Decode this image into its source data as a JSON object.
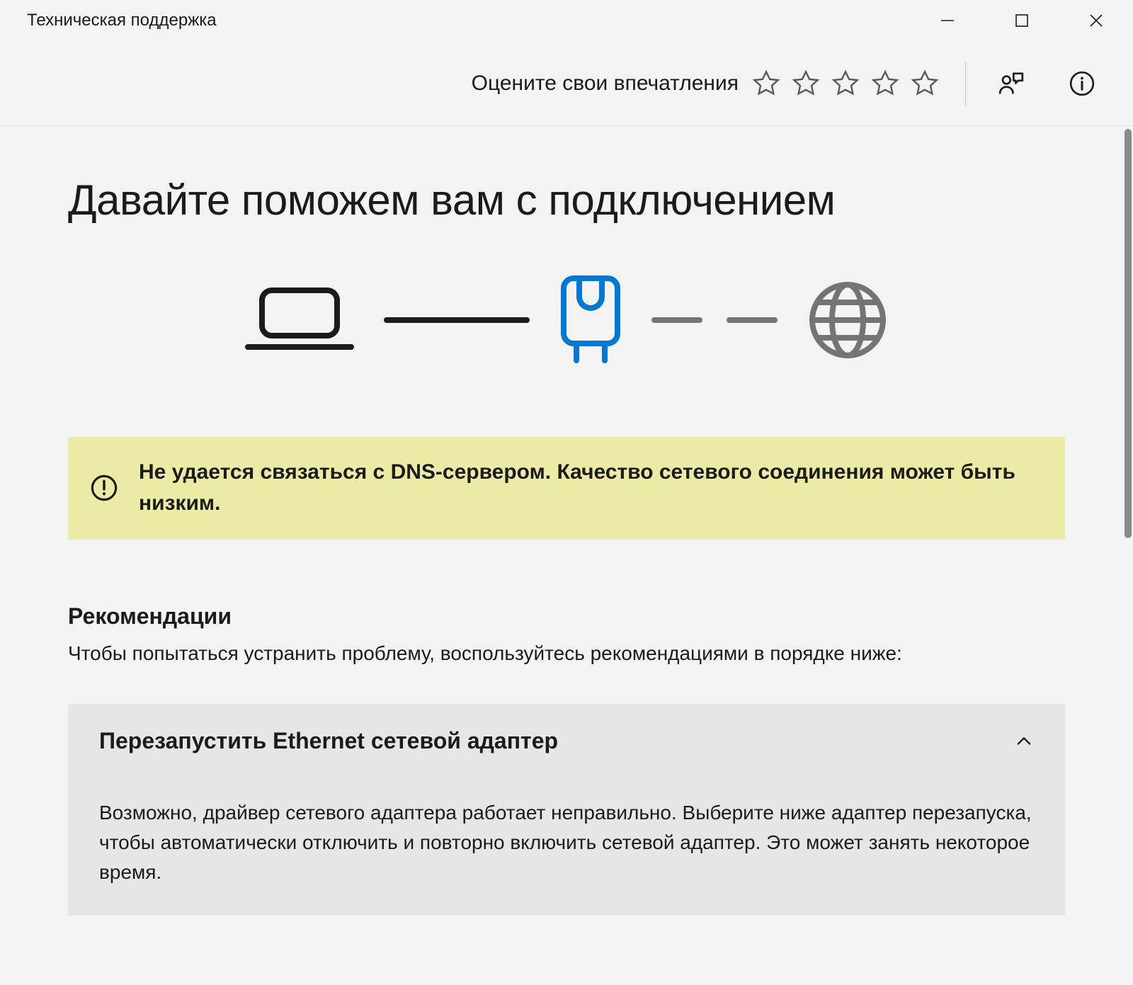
{
  "window": {
    "title": "Техническая поддержка"
  },
  "toolbar": {
    "rating_label": "Оцените свои впечатления"
  },
  "page": {
    "title": "Давайте поможем вам с подключением"
  },
  "warning": {
    "message": "Не удается связаться с DNS-сервером. Качество сетевого соединения может быть низким."
  },
  "recommendations": {
    "heading": "Рекомендации",
    "subtext": "Чтобы попытаться устранить проблему, воспользуйтесь рекомендациями в порядке ниже:",
    "items": [
      {
        "title": "Перезапустить Ethernet сетевой адаптер",
        "body": "Возможно, драйвер сетевого адаптера работает неправильно. Выберите ниже адаптер перезапуска, чтобы автоматически отключить и повторно включить сетевой адаптер. Это может занять некоторое время."
      }
    ]
  }
}
